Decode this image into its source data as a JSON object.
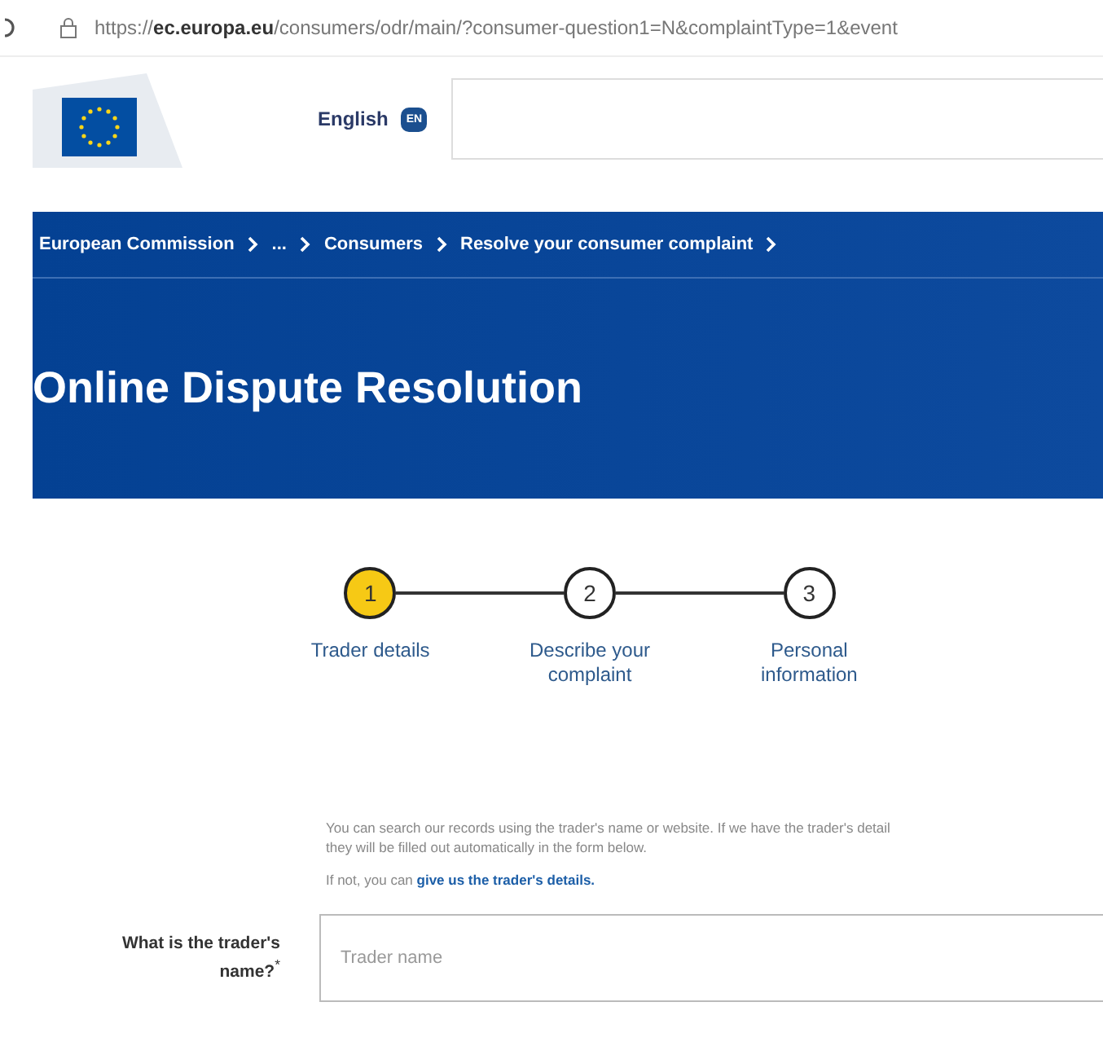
{
  "address_bar": {
    "url": "https://**ec.europa.eu**/consumers/odr/main/?consumer-question1=N&complaintType=1&event"
  },
  "header": {
    "language": "English",
    "language_code": "EN"
  },
  "breadcrumb": [
    "European Commission",
    "...",
    "Consumers",
    "Resolve your consumer complaint"
  ],
  "page_title": "Online Dispute Resolution",
  "steps": [
    {
      "number": "1",
      "label": "Trader details",
      "selected": true
    },
    {
      "number": "2",
      "label": "Describe your complaint",
      "selected": false
    },
    {
      "number": "3",
      "label": "Personal information",
      "selected": false
    }
  ],
  "intro": {
    "text": "You can search our records using the trader's name or website. If we have the trader's detail\nthey will be filled out automatically in the form below.",
    "alt_prefix": "If not, you can",
    "alt_link": "give us the trader's details."
  },
  "trader_field": {
    "label": "What is the trader's name?",
    "required_mark": "*",
    "placeholder": "Trader name"
  }
}
